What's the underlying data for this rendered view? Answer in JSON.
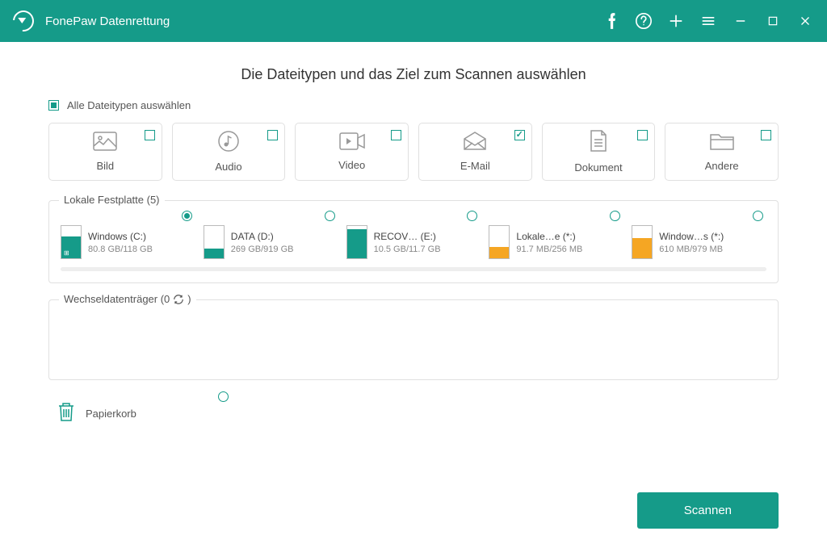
{
  "app": {
    "title": "FonePaw Datenrettung"
  },
  "main": {
    "heading": "Die Dateitypen und das Ziel zum Scannen auswählen",
    "selectAllLabel": "Alle Dateitypen auswählen",
    "filetypes": [
      {
        "label": "Bild",
        "checked": false
      },
      {
        "label": "Audio",
        "checked": false
      },
      {
        "label": "Video",
        "checked": false
      },
      {
        "label": "E-Mail",
        "checked": true
      },
      {
        "label": "Dokument",
        "checked": false
      },
      {
        "label": "Andere",
        "checked": false
      }
    ],
    "localDrives": {
      "legend": "Lokale Festplatte (5)",
      "items": [
        {
          "name": "Windows (C:)",
          "size": "80.8 GB/118 GB",
          "fill": 68,
          "color": "teal",
          "selected": true,
          "win": true
        },
        {
          "name": "DATA (D:)",
          "size": "269 GB/919 GB",
          "fill": 29,
          "color": "teal",
          "selected": false,
          "win": false
        },
        {
          "name": "RECOV… (E:)",
          "size": "10.5 GB/11.7 GB",
          "fill": 90,
          "color": "teal",
          "selected": false,
          "win": false
        },
        {
          "name": "Lokale…e (*:)",
          "size": "91.7 MB/256 MB",
          "fill": 36,
          "color": "orange",
          "selected": false,
          "win": false
        },
        {
          "name": "Window…s (*:)",
          "size": "610 MB/979 MB",
          "fill": 62,
          "color": "orange",
          "selected": false,
          "win": false
        }
      ]
    },
    "removable": {
      "legend": "Wechseldatenträger (0"
    },
    "recycle": {
      "label": "Papierkorb"
    },
    "scanButton": "Scannen"
  }
}
